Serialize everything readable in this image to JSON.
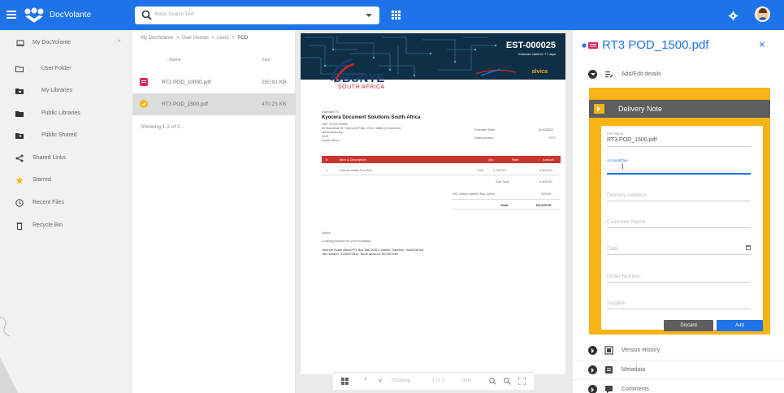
{
  "app": {
    "brand": "DocVolante",
    "search_placeholder": "Basic Search Text",
    "colors": {
      "primary": "#1e73e8",
      "accent": "#f8b316",
      "danger": "#c8372d",
      "dark": "#5e5e5e"
    }
  },
  "sidebar": {
    "items": [
      {
        "label": "My DocVolante",
        "icon": "laptop-icon"
      },
      {
        "label": "User Folder",
        "icon": "folder-outline-icon"
      },
      {
        "label": "My Libraries",
        "icon": "folder-library-icon"
      },
      {
        "label": "Public Libraries",
        "icon": "folder-icon"
      },
      {
        "label": "Public Shared",
        "icon": "folder-shared-icon"
      },
      {
        "label": "Shared Links",
        "icon": "share-icon"
      },
      {
        "label": "Starred",
        "icon": "star-icon"
      },
      {
        "label": "Recent Files",
        "icon": "clock-icon"
      },
      {
        "label": "Recycle Bin",
        "icon": "trash-icon"
      }
    ]
  },
  "filelist": {
    "breadcrumbs": [
      "My DocVolante",
      "User Homes",
      "user1",
      "POD"
    ],
    "separator": ">",
    "col_name": "Name",
    "col_size": "Size",
    "sort_indicator": "↑",
    "rows": [
      {
        "name": "RT3 POD_10000.pdf",
        "size": "250.91 KB",
        "badge_color": "#e0245e"
      },
      {
        "name": "RT3 POD_1500.pdf",
        "size": "470.23 KB",
        "badge_color": "#f8b316"
      }
    ],
    "showing": "Showing 1-2 of 2..."
  },
  "document": {
    "estimate_no": "EST-000025",
    "estimate_sub": "Estimate valid for 77 days",
    "brand_alvica": "alvica",
    "logo_main": "UBUNYE",
    "logo_sub": "SOUTH AFRICA",
    "estimate_to": "Estimate To",
    "client_name": "Kyocera Document Solutions South-Africa",
    "client_lines": [
      "VAT: 4740175906",
      "49 Bauhinia St, Highveld Park, Irene Valley (Centurion)",
      "Johannesburg",
      "1491",
      "South Africa"
    ],
    "estimate_date_label": "Estimate Date :",
    "estimate_date": "11/10/2022",
    "sales_label": "Sales person :",
    "sales_value": "RTS",
    "table_cols": [
      "#",
      "Item & Description",
      "Qty",
      "Rate",
      "Amount"
    ],
    "item": {
      "no": "1",
      "desc": "Ubuntu Wbst Thin Box",
      "qty": "2.00",
      "rate": "1,750.00",
      "amount": "3,500.00"
    },
    "sub_total_label": "Sub Total",
    "sub_total": "3,500.00",
    "vat_label": "VAT (Value Added Tax) (15%)",
    "vat": "525.00",
    "total_label": "Total",
    "total": "R4,025.00",
    "notes_label": "Notes",
    "notes_text": "Looking forward for your business.",
    "footer_1": "Ubunye South Africa PO Box 565 0002 Lonehill, Sandton, South Africa",
    "footer_2": "Tax number: 4250372831, Bank account: 523397269",
    "viewer_page": "Showing",
    "viewer_pages": "1 of 1",
    "viewer_next": "Next"
  },
  "rpanel": {
    "title": "RT3 POD_1500.pdf",
    "close": "×",
    "add_edit": "Add/Edit details",
    "form_title": "Delivery Note",
    "fields": [
      {
        "label": "File Name",
        "value": "RT3 POD_1500.pdf",
        "placeholder": ""
      },
      {
        "label": "Account/Due",
        "value": "",
        "placeholder": ""
      },
      {
        "label": "",
        "value": "",
        "placeholder": "Delivery Address"
      },
      {
        "label": "",
        "value": "",
        "placeholder": "Customer Name"
      },
      {
        "label": "",
        "value": "",
        "placeholder": "Date"
      },
      {
        "label": "",
        "value": "",
        "placeholder": "Order Number"
      },
      {
        "label": "",
        "value": "",
        "placeholder": "Supplier"
      }
    ],
    "discard": "Discard",
    "add": "Add",
    "sections": [
      "Version History",
      "Metadata",
      "Comments"
    ]
  }
}
